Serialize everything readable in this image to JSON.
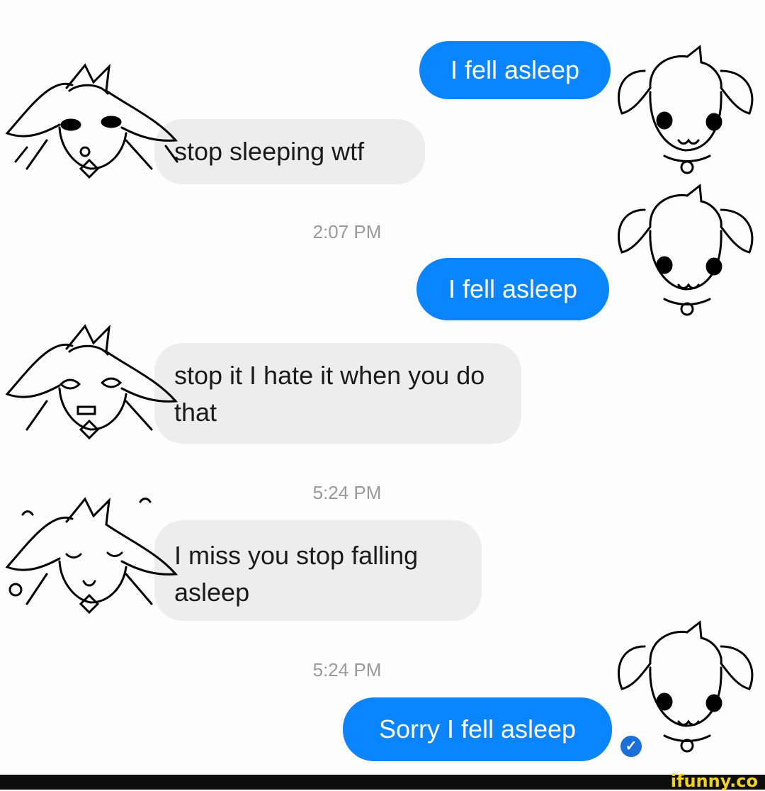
{
  "messages": [
    {
      "text": "I fell asleep"
    },
    {
      "text": "stop sleeping wtf"
    },
    {
      "text": "I fell asleep"
    },
    {
      "text": "stop it I hate it when you do that"
    },
    {
      "text": "I miss you stop falling asleep"
    },
    {
      "text": "Sorry I fell asleep"
    }
  ],
  "timestamps": [
    "2:07 PM",
    "5:24 PM",
    "5:24 PM"
  ],
  "read_receipt_icon": "check-circle-icon",
  "watermark": {
    "text": "ifunny.co",
    "color": "#f2d21b"
  },
  "colors": {
    "outgoing_bubble": "#0a84ff",
    "incoming_bubble": "#ededed",
    "timestamp": "#9a9a9a"
  }
}
